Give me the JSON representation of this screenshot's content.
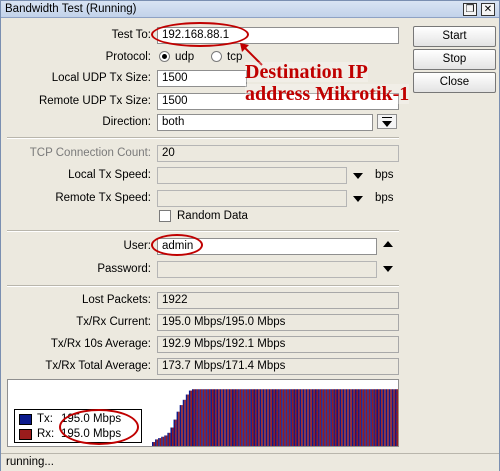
{
  "window": {
    "title": "Bandwidth Test (Running)"
  },
  "titlebar_buttons": {
    "restore": "❐",
    "close": "✕"
  },
  "buttons": {
    "start": "Start",
    "stop": "Stop",
    "close": "Close"
  },
  "form": {
    "test_to": {
      "label": "Test To:",
      "value": "192.168.88.1"
    },
    "protocol": {
      "label": "Protocol:",
      "options": [
        "udp",
        "tcp"
      ],
      "selected": "udp"
    },
    "local_udp_tx_size": {
      "label": "Local UDP Tx Size:",
      "value": "1500"
    },
    "remote_udp_tx_size": {
      "label": "Remote UDP Tx Size:",
      "value": "1500"
    },
    "direction": {
      "label": "Direction:",
      "value": "both"
    },
    "tcp_connection_count": {
      "label": "TCP Connection Count:",
      "value": "20"
    },
    "local_tx_speed": {
      "label": "Local Tx Speed:",
      "value": "",
      "unit": "bps"
    },
    "remote_tx_speed": {
      "label": "Remote Tx Speed:",
      "value": "",
      "unit": "bps"
    },
    "random_data": {
      "label": "Random Data",
      "checked": false
    },
    "user": {
      "label": "User:",
      "value": "admin"
    },
    "password": {
      "label": "Password:",
      "value": ""
    }
  },
  "stats": {
    "lost_packets": {
      "label": "Lost Packets:",
      "value": "1922"
    },
    "current": {
      "label": "Tx/Rx Current:",
      "value": "195.0 Mbps/195.0 Mbps"
    },
    "avg10s": {
      "label": "Tx/Rx 10s Average:",
      "value": "192.9 Mbps/192.1 Mbps"
    },
    "total_avg": {
      "label": "Tx/Rx Total Average:",
      "value": "173.7 Mbps/171.4 Mbps"
    }
  },
  "graph": {
    "legend": [
      {
        "name": "Tx:",
        "value": "195.0 Mbps",
        "color": "#0b1a8c"
      },
      {
        "name": "Rx:",
        "value": "195.0 Mbps",
        "color": "#9b1c1c"
      }
    ],
    "tx_color": "#0b1a8c",
    "rx_color": "#9b1c1c",
    "samples": [
      0.06,
      0.1,
      0.12,
      0.14,
      0.16,
      0.2,
      0.28,
      0.4,
      0.52,
      0.62,
      0.7,
      0.78,
      0.84,
      0.86,
      0.86,
      0.86,
      0.86,
      0.86,
      0.86,
      0.86,
      0.86,
      0.86,
      0.86,
      0.86,
      0.86,
      0.86,
      0.86,
      0.86,
      0.86,
      0.86,
      0.86,
      0.86,
      0.86,
      0.86,
      0.86,
      0.86,
      0.86,
      0.86,
      0.86,
      0.86,
      0.86,
      0.86,
      0.86,
      0.86,
      0.86,
      0.86,
      0.86,
      0.86,
      0.86,
      0.86,
      0.86,
      0.86,
      0.86,
      0.86,
      0.86,
      0.86,
      0.86,
      0.86,
      0.86,
      0.86,
      0.86,
      0.86,
      0.86,
      0.86,
      0.86,
      0.86,
      0.86,
      0.86,
      0.86,
      0.86,
      0.86,
      0.86,
      0.86,
      0.86,
      0.86,
      0.86,
      0.86,
      0.86,
      0.86,
      0.86
    ]
  },
  "annotation": {
    "line1": "Destination IP",
    "line2": "address Mikrotik-1",
    "color": "#c00000"
  },
  "status": {
    "text": "running..."
  }
}
